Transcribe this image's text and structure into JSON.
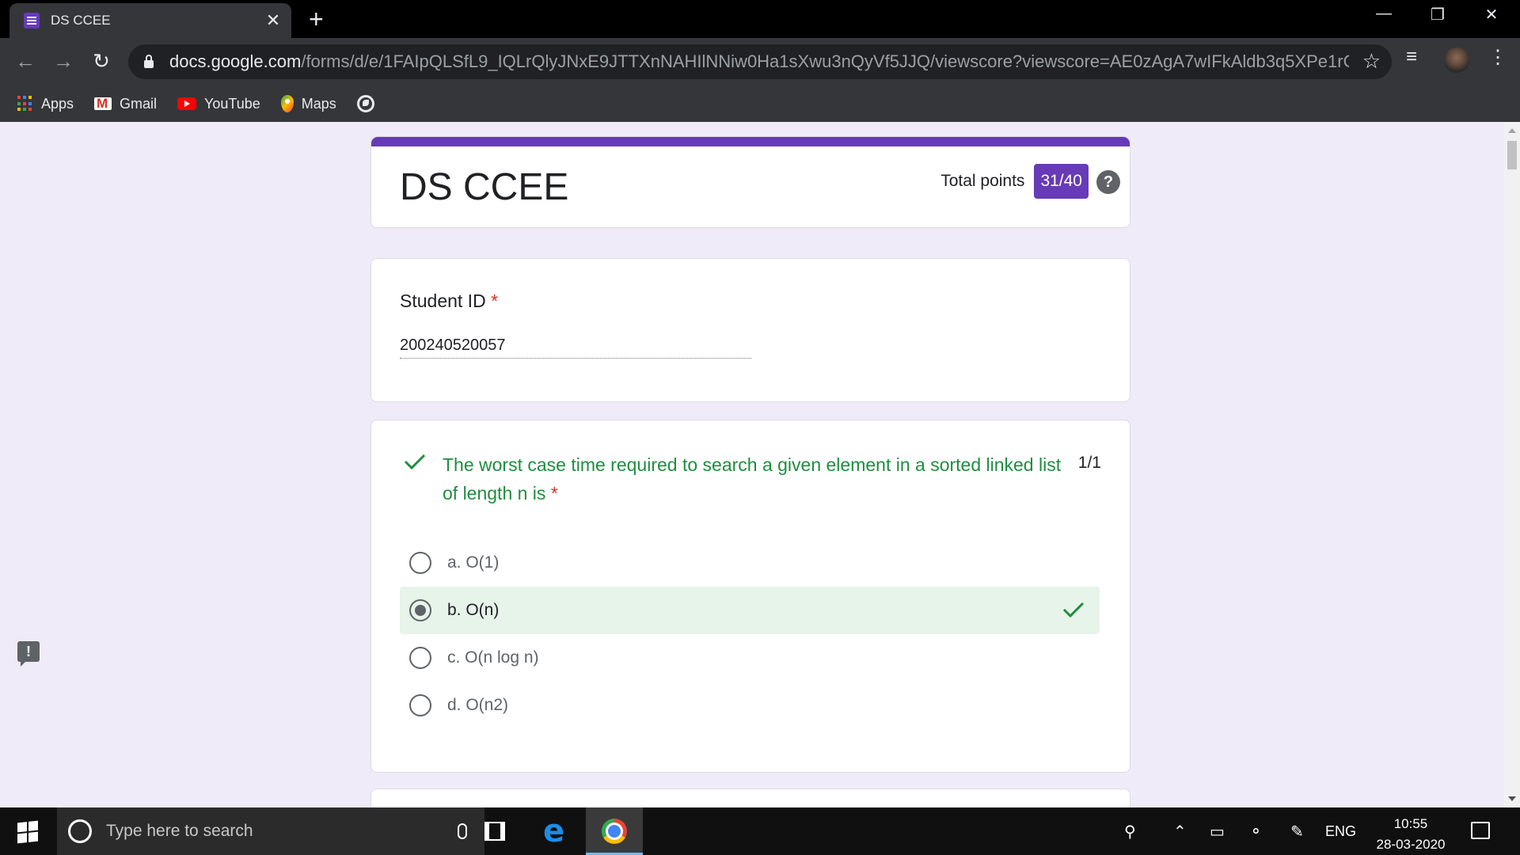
{
  "browser": {
    "tab_title": "DS CCEE",
    "url_host": "docs.google.com",
    "url_path": "/forms/d/e/1FAIpQLSfL9_IQLrQlyJNxE9JTTXnNAHIlNNiw0Ha1sXwu3nQyVf5JJQ/viewscore?viewscore=AE0zAgA7wIFkAldb3q5XPe1rCvrdec7hN...",
    "bookmarks": [
      {
        "label": "Apps",
        "icon": "apps-grid-icon"
      },
      {
        "label": "Gmail",
        "icon": "gmail-icon"
      },
      {
        "label": "YouTube",
        "icon": "youtube-icon"
      },
      {
        "label": "Maps",
        "icon": "maps-icon"
      }
    ]
  },
  "form": {
    "title": "DS CCEE",
    "total_points_label": "Total points",
    "total_points_value": "31/40",
    "help_symbol": "?",
    "accent_color": "#673ab7"
  },
  "student_question": {
    "label": "Student ID",
    "required_mark": "*",
    "answer": "200240520057"
  },
  "question1": {
    "text": "The worst case time required to search a given element in a sorted linked list of length n is",
    "required_mark": "*",
    "score": "1/1",
    "status_color": "#1e8e3e",
    "options": [
      {
        "label": "a. O(1)",
        "selected": false,
        "correct": false
      },
      {
        "label": "b. O(n)",
        "selected": true,
        "correct": true
      },
      {
        "label": "c. O(n log n)",
        "selected": false,
        "correct": false
      },
      {
        "label": "d. O(n2)",
        "selected": false,
        "correct": false
      }
    ]
  },
  "feedback_symbol": "!",
  "taskbar": {
    "search_placeholder": "Type here to search",
    "language": "ENG",
    "time": "10:55",
    "date": "28-03-2020"
  }
}
